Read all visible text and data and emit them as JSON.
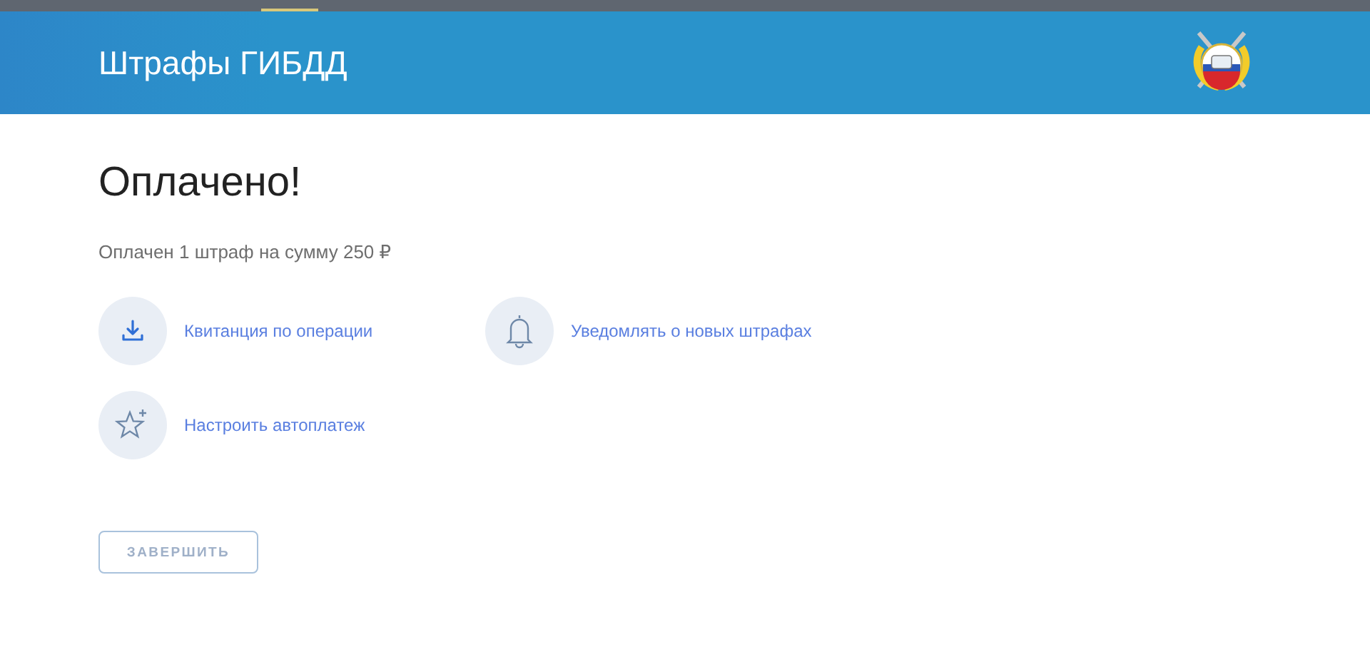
{
  "header": {
    "title": "Штрафы ГИБДД"
  },
  "title": "Оплачено!",
  "summary": "Оплачен 1 штраф на сумму 250 ₽",
  "actions": [
    {
      "kind": "download",
      "label": "Квитанция по операции"
    },
    {
      "kind": "bell",
      "label": "Уведомлять о новых штрафах"
    },
    {
      "kind": "star",
      "label": "Настроить автоплатеж"
    }
  ],
  "finish_button": "ЗАВЕРШИТЬ"
}
